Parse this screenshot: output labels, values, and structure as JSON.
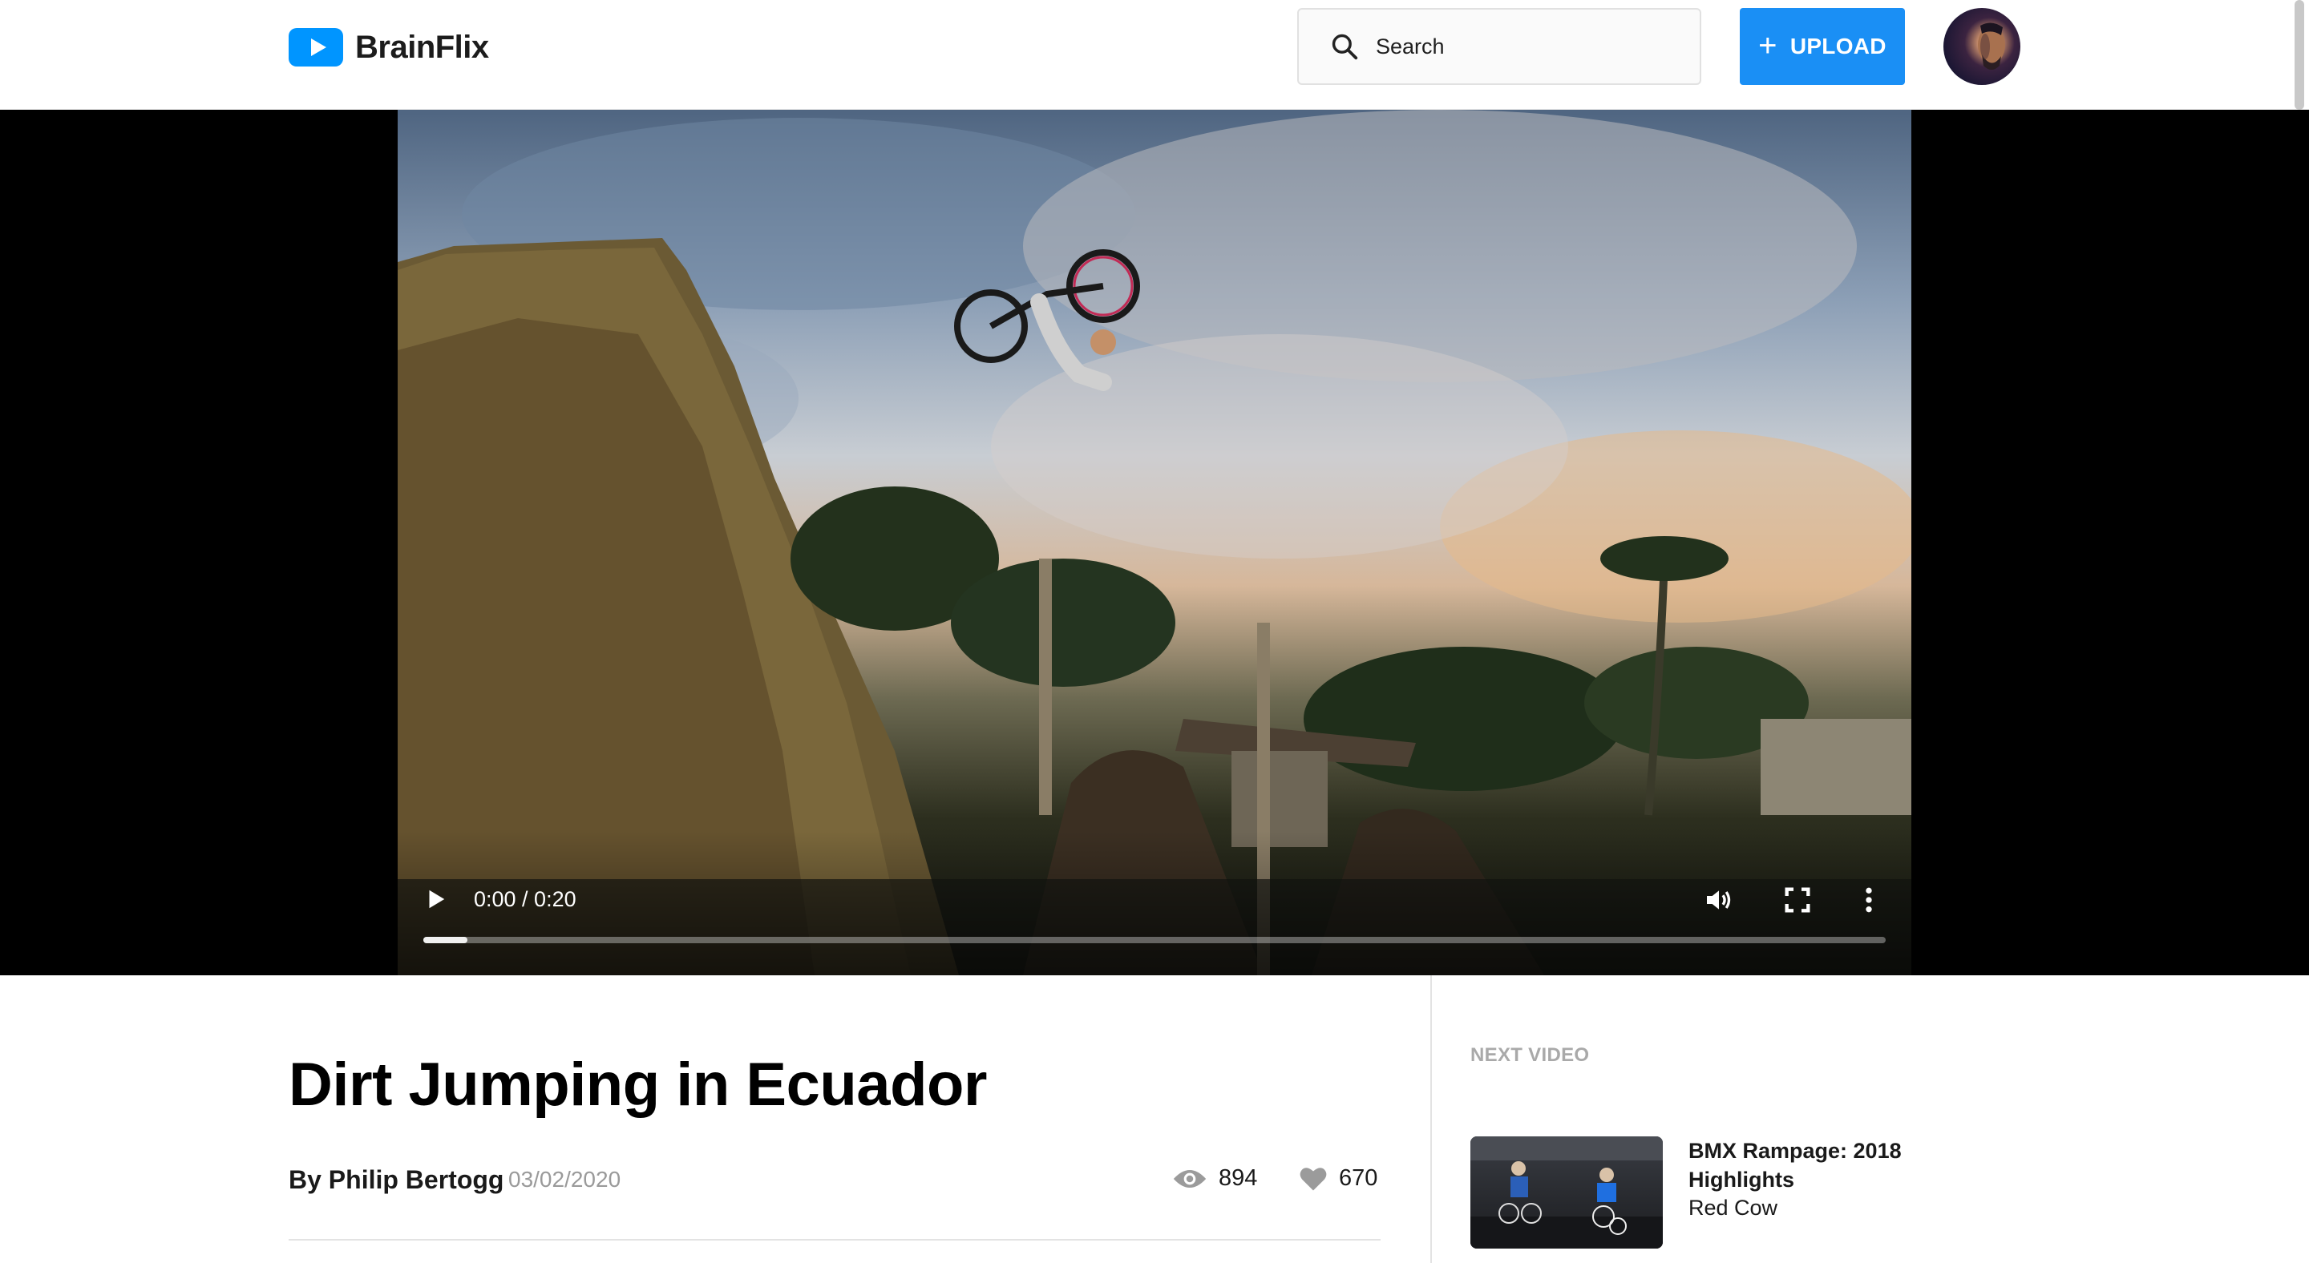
{
  "app": {
    "name": "BrainFlix"
  },
  "header": {
    "search_placeholder": "Search",
    "upload_label": "UPLOAD",
    "plus_symbol": "+"
  },
  "player": {
    "time": "0:00 / 0:20",
    "progress_fraction": 0.03
  },
  "video": {
    "title": "Dirt Jumping in Ecuador",
    "byline": "By Philip Bertogg",
    "date": "03/02/2020",
    "views": "894",
    "likes": "670"
  },
  "next": {
    "label": "NEXT VIDEO",
    "items": [
      {
        "title": "BMX Rampage: 2018 Highlights",
        "channel": "Red Cow"
      }
    ]
  },
  "colors": {
    "brand": "#0095ff",
    "upload_button": "#1a8ff5",
    "muted_text": "#9a9a9a"
  }
}
